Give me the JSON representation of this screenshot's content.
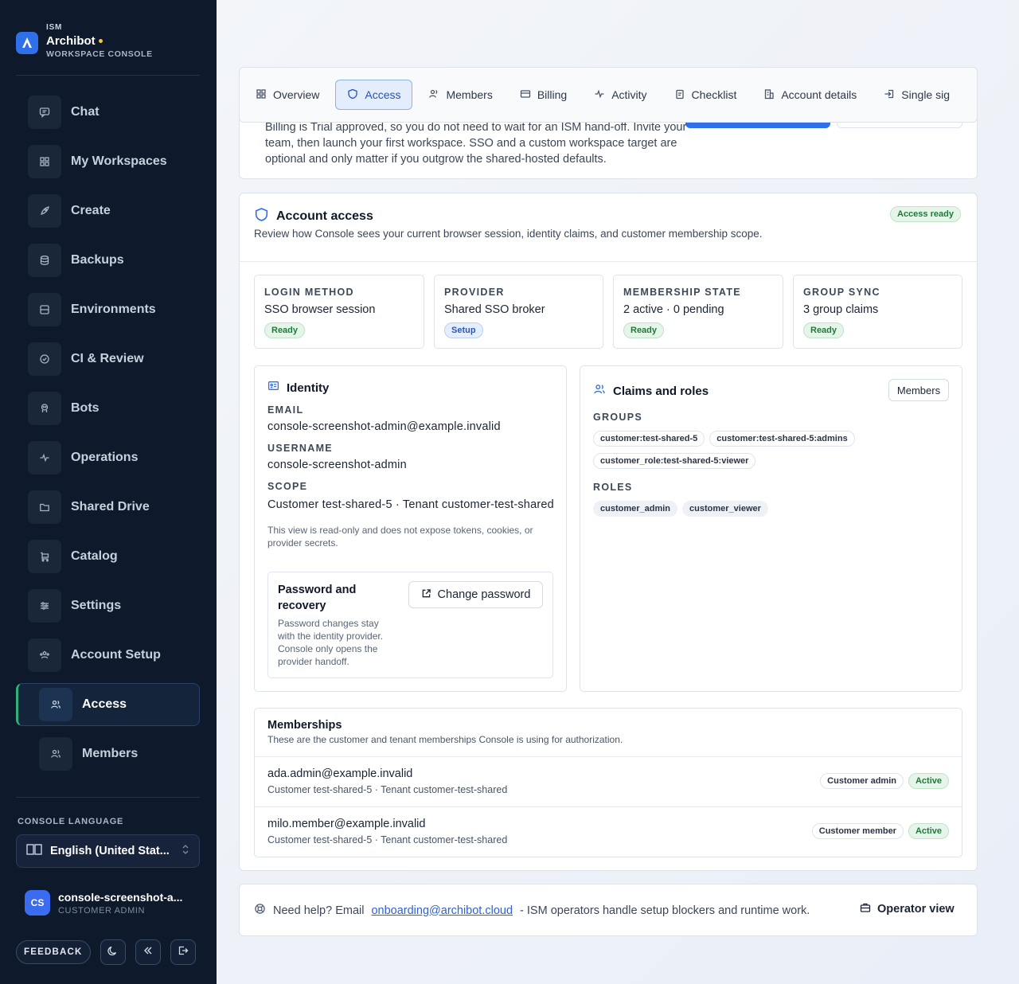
{
  "brand": {
    "kicker": "ISM",
    "name": "Archibot",
    "subtitle": "WORKSPACE CONSOLE"
  },
  "nav": {
    "items": [
      {
        "label": "Chat",
        "icon": "chat-icon"
      },
      {
        "label": "My Workspaces",
        "icon": "grid-icon"
      },
      {
        "label": "Create",
        "icon": "rocket-icon"
      },
      {
        "label": "Backups",
        "icon": "database-icon"
      },
      {
        "label": "Environments",
        "icon": "server-icon"
      },
      {
        "label": "CI & Review",
        "icon": "check-circle-icon"
      },
      {
        "label": "Bots",
        "icon": "bot-icon"
      },
      {
        "label": "Operations",
        "icon": "activity-icon"
      },
      {
        "label": "Shared Drive",
        "icon": "folder-icon"
      },
      {
        "label": "Catalog",
        "icon": "cart-icon"
      },
      {
        "label": "Settings",
        "icon": "sliders-icon"
      },
      {
        "label": "Account Setup",
        "icon": "users-icon"
      },
      {
        "label": "Access",
        "icon": "users-icon"
      },
      {
        "label": "Members",
        "icon": "users-icon"
      }
    ]
  },
  "language": {
    "label": "CONSOLE LANGUAGE",
    "value": "English (United Stat..."
  },
  "user": {
    "initials": "CS",
    "name": "console-screenshot-a...",
    "role": "CUSTOMER ADMIN"
  },
  "footer_actions": {
    "feedback": "FEEDBACK"
  },
  "tabs": [
    "Overview",
    "Access",
    "Members",
    "Billing",
    "Activity",
    "Checklist",
    "Account details",
    "Single sig"
  ],
  "intro": {
    "text": "Billing is Trial approved, so you do not need to wait for an ISM hand-off. Invite your team, then launch your first workspace. SSO and a custom workspace target are optional and only matter if you outgrow the shared-hosted defaults."
  },
  "access": {
    "title": "Account access",
    "status": "Access ready",
    "description": "Review how Console sees your current browser session, identity claims, and customer membership scope.",
    "stats": [
      {
        "label": "LOGIN METHOD",
        "value": "SSO browser session",
        "badge": "Ready"
      },
      {
        "label": "PROVIDER",
        "value": "Shared SSO broker",
        "badge": "Setup"
      },
      {
        "label": "MEMBERSHIP STATE",
        "value": "2 active · 0 pending",
        "badge": "Ready"
      },
      {
        "label": "GROUP SYNC",
        "value": "3 group claims",
        "badge": "Ready"
      }
    ]
  },
  "identity": {
    "title": "Identity",
    "email_label": "EMAIL",
    "email": "console-screenshot-admin@example.invalid",
    "username_label": "USERNAME",
    "username": "console-screenshot-admin",
    "scope_label": "SCOPE",
    "scope": "Customer test-shared-5 · Tenant customer-test-shared",
    "note": "This view is read-only and does not expose tokens, cookies, or provider secrets.",
    "password_title": "Password and recovery",
    "password_note": "Password changes stay with the identity provider. Console only opens the provider handoff.",
    "change_password": "Change password"
  },
  "claims": {
    "title": "Claims and roles",
    "members_button": "Members",
    "groups_label": "GROUPS",
    "groups": [
      "customer:test-shared-5",
      "customer:test-shared-5:admins",
      "customer_role:test-shared-5:viewer"
    ],
    "roles_label": "ROLES",
    "roles": [
      "customer_admin",
      "customer_viewer"
    ]
  },
  "memberships": {
    "title": "Memberships",
    "description": "These are the customer and tenant memberships Console is using for authorization.",
    "rows": [
      {
        "email": "ada.admin@example.invalid",
        "scope": "Customer test-shared-5 · Tenant customer-test-shared",
        "role": "Customer admin",
        "status": "Active"
      },
      {
        "email": "milo.member@example.invalid",
        "scope": "Customer test-shared-5 · Tenant customer-test-shared",
        "role": "Customer member",
        "status": "Active"
      }
    ]
  },
  "help": {
    "prefix": "Need help? Email",
    "email": "onboarding@archibot.cloud",
    "suffix": "- ISM operators handle setup blockers and runtime work.",
    "operator_view": "Operator view"
  },
  "colors": {
    "sidebar_bg": "#0e1a2b",
    "accent": "#2f6fe8",
    "active_border": "#2fb07c",
    "ready_green": "#1f7a3a"
  }
}
